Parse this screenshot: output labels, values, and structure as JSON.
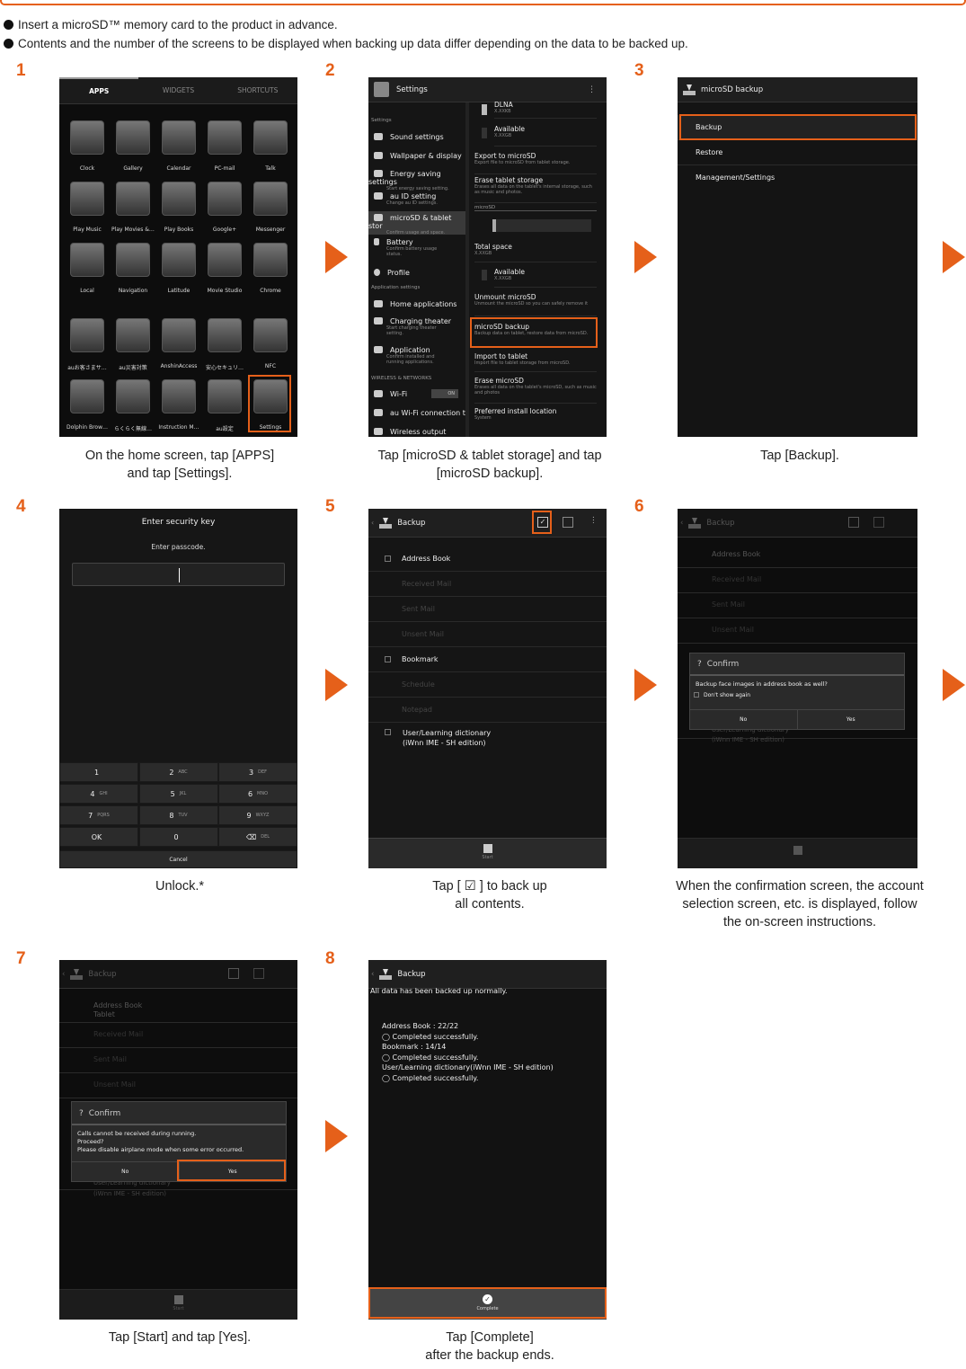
{
  "intro": {
    "bullet1": "Insert a microSD™ memory card to the product in advance.",
    "bullet2": "Contents and the number of the screens to be displayed when backing up data differ depending on the data to be backed up."
  },
  "steps": [
    "1",
    "2",
    "3",
    "4",
    "5",
    "6",
    "7",
    "8"
  ],
  "captions": {
    "s1a": "On the home screen, tap [APPS]",
    "s1b": "and tap [Settings].",
    "s2a": "Tap [microSD & tablet storage] and tap",
    "s2b": "[microSD backup].",
    "s3": "Tap [Backup].",
    "s4": "Unlock.*",
    "s5a": "Tap [ ☑ ] to back up",
    "s5b": "all contents.",
    "s6a": "When the confirmation screen, the account",
    "s6b": "selection screen, etc. is displayed, follow",
    "s6c": "the on-screen instructions.",
    "s7": "Tap [Start] and tap [Yes].",
    "s8a": "Tap [Complete]",
    "s8b": "after the backup ends."
  },
  "screen1": {
    "tabs": [
      "APPS",
      "WIDGETS",
      "SHORTCUTS"
    ],
    "apps": [
      "Clock",
      "Gallery",
      "Calendar",
      "PC-mail",
      "Talk",
      "Play Music",
      "Play Movies &…",
      "Play Books",
      "Google+",
      "Messenger",
      "Local",
      "Navigation",
      "Latitude",
      "Movie Studio",
      "Chrome",
      "auお客さまサ…",
      "au災害対策",
      "AnshinAccess",
      "安心セキュリ…",
      "NFC",
      "Dolphin Brow…",
      "らくらく無線…",
      "Instruction M…",
      "au設定",
      "Settings"
    ]
  },
  "screen2": {
    "title": "Settings",
    "side": {
      "h1": "Settings",
      "sound": "Sound settings",
      "wall": "Wallpaper & display",
      "energy": "Energy saving settings",
      "energy_sub": "Start energy saving setting.",
      "auid": "au ID setting",
      "auid_sub": "Change au ID settings.",
      "microsd": "microSD & tablet stor",
      "microsd_sub": "Confirm usage and space.",
      "battery": "Battery",
      "battery_sub": "Confirm battery usage status.",
      "profile": "Profile",
      "h2": "Application settings",
      "home": "Home applications",
      "charging": "Charging theater",
      "charging_sub": "Start charging theater setting.",
      "app": "Application",
      "app_sub": "Confirm installed and running applications.",
      "h3": "WIRELESS & NETWORKS",
      "wifi": "Wi-Fi",
      "wifi_toggle": "ON",
      "auwifi": "au Wi-Fi connection t",
      "wireless": "Wireless output"
    },
    "pane": {
      "dlna": "DLNA",
      "dlna_sub": "X.XXKB",
      "avail1": "Available",
      "avail1_sub": "X.XXGB",
      "export": "Export to microSD",
      "export_sub": "Export file to microSD from tablet storage.",
      "erase": "Erase tablet storage",
      "erase_sub": "Erases all data on the tablet's internal storage, such as music and photos.",
      "hdr_sd": "microSD",
      "total": "Total space",
      "total_sub": "X.XXGB",
      "avail2": "Available",
      "avail2_sub": "X.XXGB",
      "unmount": "Unmount microSD",
      "unmount_sub": "Unmount the microSD so you can safely remove it",
      "backup": "microSD backup",
      "backup_sub": "Backup data on tablet, restore data from microSD.",
      "import": "Import to tablet",
      "import_sub": "Import file to tablet storage from microSD.",
      "erasesd": "Erase microSD",
      "erasesd_sub": "Erases all data on the tablet's microSD, such as music and photos",
      "pref": "Preferred install location",
      "pref_sub": "System"
    }
  },
  "screen3": {
    "title": "microSD backup",
    "items": [
      "Backup",
      "Restore",
      "Management/Settings"
    ]
  },
  "screen4": {
    "title": "Enter security key",
    "prompt": "Enter passcode.",
    "keys": [
      {
        "k": "1",
        "s": ""
      },
      {
        "k": "2",
        "s": "ABC"
      },
      {
        "k": "3",
        "s": "DEF"
      },
      {
        "k": "4",
        "s": "GHI"
      },
      {
        "k": "5",
        "s": "JKL"
      },
      {
        "k": "6",
        "s": "MNO"
      },
      {
        "k": "7",
        "s": "PQRS"
      },
      {
        "k": "8",
        "s": "TUV"
      },
      {
        "k": "9",
        "s": "WXYZ"
      },
      {
        "k": "OK",
        "s": ""
      },
      {
        "k": "0",
        "s": ""
      },
      {
        "k": "⌫",
        "s": "DEL"
      }
    ],
    "cancel": "Cancel"
  },
  "backup": {
    "title": "Backup",
    "items": [
      "Address Book",
      "Received Mail",
      "Sent Mail",
      "Unsent Mail",
      "Bookmark",
      "Schedule",
      "Notepad"
    ],
    "dict1": "User/Learning dictionary",
    "dict2": "(iWnn IME - SH edition)",
    "start": "Start",
    "tablet": "Tablet"
  },
  "screen6": {
    "confirm": "Confirm",
    "msg": "Backup face images in address book as well?",
    "dont": "Don't show again",
    "no": "No",
    "yes": "Yes"
  },
  "screen7": {
    "confirm": "Confirm",
    "msg1": "Calls cannot be received during running.",
    "msg2": "Proceed?",
    "msg3": "Please disable airplane mode when some error occurred.",
    "no": "No",
    "yes": "Yes"
  },
  "screen8": {
    "title": "Backup",
    "done": "All data has been backed up normally.",
    "l1": "Address Book : 22/22",
    "l2": "◯ Completed successfully.",
    "l3": "Bookmark : 14/14",
    "l4": "◯ Completed successfully.",
    "l5": "User/Learning dictionary(iWnn IME - SH edition)",
    "l6": "◯ Completed successfully.",
    "complete": "Complete"
  },
  "colors": {
    "accent": "#e5601a"
  }
}
